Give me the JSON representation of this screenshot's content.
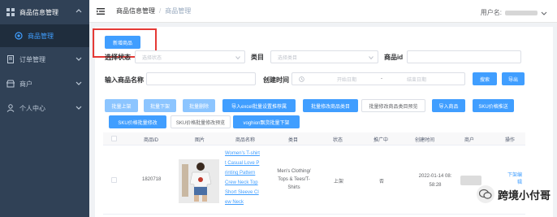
{
  "sidebar": {
    "items": [
      {
        "label": "商品信息管理"
      },
      {
        "label": "商品管理"
      },
      {
        "label": "订单管理"
      },
      {
        "label": "商户"
      },
      {
        "label": "个人中心"
      }
    ]
  },
  "header": {
    "breadcrumb": [
      "商品信息管理",
      "商品管理"
    ],
    "user_label": "用户名:"
  },
  "toolbar_top": {
    "new_product": "新增商品"
  },
  "filters": {
    "status_label": "选择状态",
    "status_placeholder": "选择状态",
    "category_label": "类目",
    "category_placeholder": "选择类目",
    "product_id_label": "商品id",
    "name_label": "输入商品名称",
    "created_label": "创建时间",
    "start_placeholder": "开始日期",
    "range_sep": "-",
    "end_placeholder": "结束日期",
    "search": "搜索",
    "export": "导出"
  },
  "actions": {
    "row1": [
      "批量上架",
      "批量下架",
      "批量删除",
      "导入excel批量设置推荐属",
      "批量修改商品类目",
      "批量修改商品类目预览",
      "导入商品",
      "SKU价格推送"
    ],
    "row2": [
      "SKU价格批量修改",
      "SKU价格批量修改预览",
      "voghion飘货批量下架"
    ]
  },
  "table": {
    "headers": [
      "商品ID",
      "图片",
      "商品名称",
      "类目",
      "状态",
      "推广中",
      "创建时间",
      "商户",
      "操作"
    ],
    "rows": [
      {
        "id": "1820718",
        "name_lines": [
          "Women's T-shirt",
          "t Casual Love P",
          "rinting Pattern",
          "Crew Neck Top",
          "Short Sleeve Cl",
          "ew Neck"
        ],
        "category_lines": [
          "Men's Clothing/",
          "Tops & Tees/T-",
          "Shirts"
        ],
        "status": "上架",
        "promoting": "否",
        "created_lines": [
          "2022-01-14 08:",
          "58:28"
        ],
        "ops": [
          "下架",
          "编辑"
        ]
      }
    ]
  },
  "watermark": "跨境小付哥",
  "colors": {
    "sidebar": "#304156",
    "primary": "#409eff",
    "highlight": "#e53935"
  }
}
